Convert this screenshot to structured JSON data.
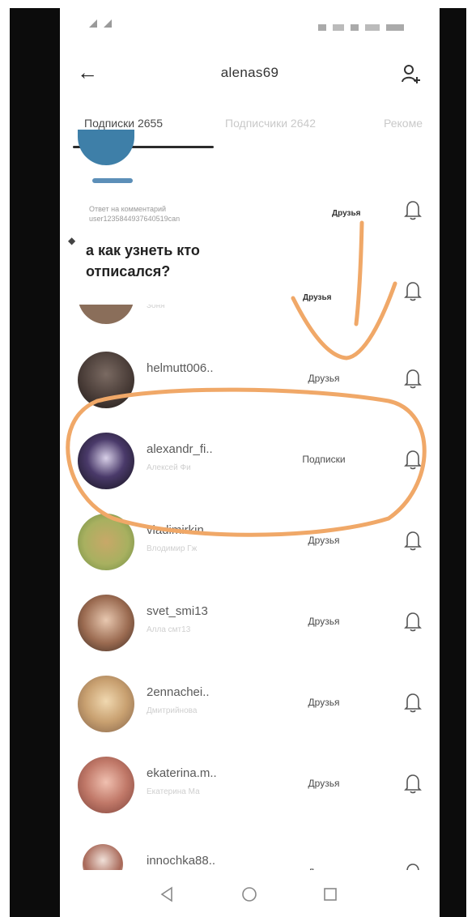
{
  "header": {
    "title": "alenas69",
    "back_icon": "arrow-left-icon",
    "add_icon": "add-user-icon"
  },
  "tabs": [
    {
      "label": "Подписки 2655",
      "active": true
    },
    {
      "label": "Подписчики 2642",
      "active": false
    },
    {
      "label": "Рекоме",
      "active": false
    }
  ],
  "comment": {
    "reply_text": "Ответ на комментарий user1235844937640519сan",
    "text": "а как узнеть кто отписался?"
  },
  "hidden_rows": [
    {
      "status": "Друзья"
    },
    {
      "status": "Друзья",
      "sub": "Зоня"
    }
  ],
  "rows": [
    {
      "username": "helmutt006..",
      "sub": "",
      "status": "Друзья"
    },
    {
      "username": "alexandr_fi..",
      "sub": "Алексей Фи",
      "status": "Подписки"
    },
    {
      "username": "vladimirkin..",
      "sub": "Влодимир Гж",
      "status": "Друзья"
    },
    {
      "username": "svet_smi13",
      "sub": "Алла смт13",
      "status": "Друзья"
    },
    {
      "username": "2ennachei..",
      "sub": "Дмитрийнова",
      "status": "Друзья"
    },
    {
      "username": "ekaterina.m..",
      "sub": "Екатерина Ма",
      "status": "Друзья"
    },
    {
      "username": "innochka88..",
      "sub": "",
      "status": "Друзья"
    }
  ],
  "colors": {
    "annotation": "#f0a868",
    "text": "#333333",
    "muted": "#cccccc"
  }
}
